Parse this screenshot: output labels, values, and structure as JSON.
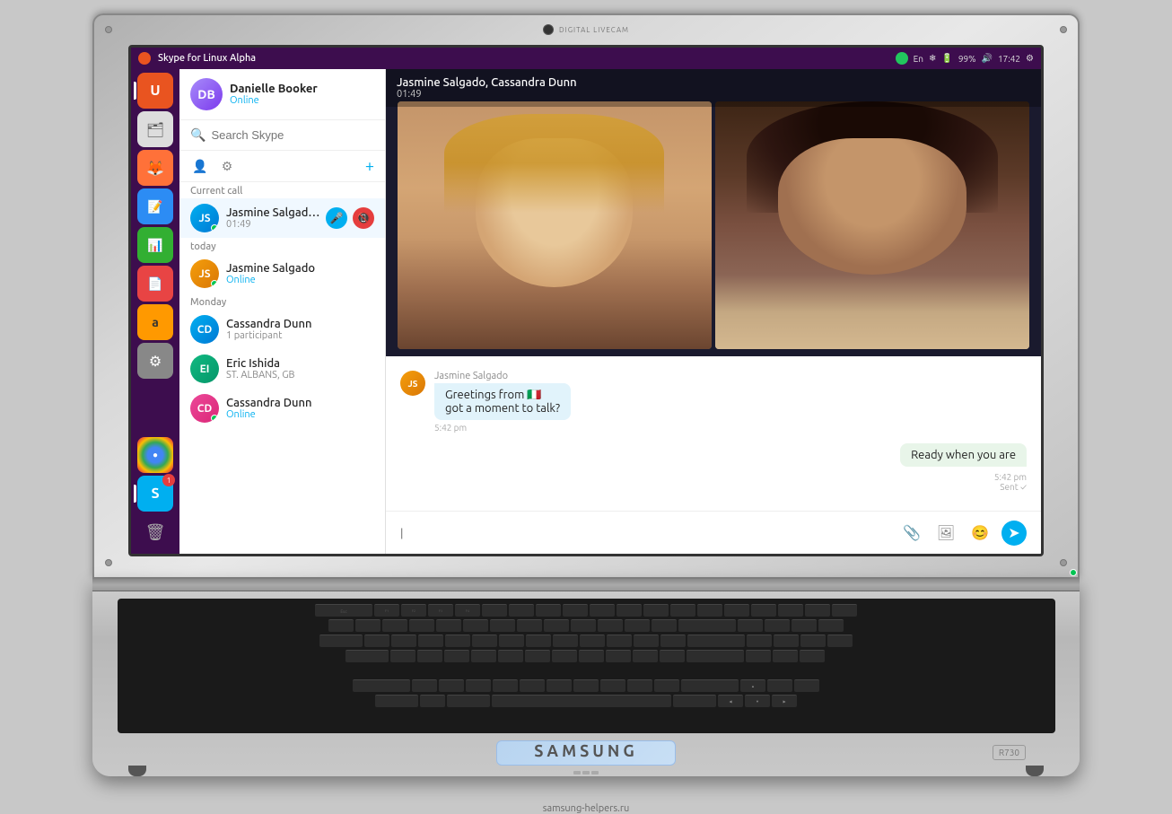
{
  "system_bar": {
    "title": "Skype for Linux Alpha",
    "time": "17:42",
    "battery": "99%",
    "indicators": [
      "●",
      "En",
      "❄",
      "🔊",
      "⚙"
    ]
  },
  "profile": {
    "name": "Danielle Booker",
    "status": "Online",
    "initials": "DB"
  },
  "search": {
    "placeholder": "Search Skype"
  },
  "toolbar": {
    "contacts_icon": "👤",
    "settings_icon": "⚙",
    "add_icon": "+"
  },
  "current_call": {
    "label": "Current call",
    "name": "Jasmine Salgado, Ca...",
    "timer": "01:49",
    "initials": "JS"
  },
  "sections": {
    "today": "today",
    "monday": "Monday"
  },
  "contacts": [
    {
      "id": "jasmine",
      "name": "Jasmine Salgado",
      "status": "Online",
      "status_type": "online",
      "initials": "JS"
    },
    {
      "id": "cassandra-group",
      "name": "Cassandra Dunn",
      "sub": "1 participant",
      "initials": "CD"
    },
    {
      "id": "eric",
      "name": "Eric Ishida",
      "sub": "ST. ALBANS, GB",
      "initials": "EI"
    },
    {
      "id": "cassandra2",
      "name": "Cassandra Dunn",
      "status": "Online",
      "status_type": "online",
      "initials": "CD"
    }
  ],
  "video_call": {
    "participants": "Jasmine Salgado, Cassandra Dunn",
    "timer": "01:49"
  },
  "messages": [
    {
      "sender": "Jasmine Salgado",
      "text1": "Greetings from 🇮🇹",
      "text2": "got a moment to talk?",
      "time": "5:42 pm",
      "type": "received"
    },
    {
      "text": "Ready when you are",
      "time": "5:42 pm",
      "type": "sent",
      "status": "Sent ✓"
    }
  ],
  "input": {
    "placeholder": "|",
    "icons": [
      "📎",
      "🖼",
      "😊",
      "➤"
    ]
  },
  "launcher": {
    "icons": [
      {
        "name": "ubuntu",
        "glyph": "🐧",
        "color": "#E95420"
      },
      {
        "name": "files",
        "glyph": "📁",
        "color": "#e0e0e0"
      },
      {
        "name": "firefox",
        "glyph": "🦊",
        "color": "#FF7139"
      },
      {
        "name": "text-editor",
        "glyph": "📝",
        "color": "#2c8cf4"
      },
      {
        "name": "spreadsheet",
        "glyph": "📊",
        "color": "#32af32"
      },
      {
        "name": "document",
        "glyph": "📄",
        "color": "#e84444"
      },
      {
        "name": "amazon",
        "glyph": "a",
        "color": "#FF9900"
      },
      {
        "name": "system-settings",
        "glyph": "⚙",
        "color": "#b0b0b0"
      },
      {
        "name": "chrome",
        "glyph": "●",
        "color": "#4285F4"
      },
      {
        "name": "skype",
        "glyph": "S",
        "color": "#00aff0"
      }
    ]
  },
  "laptop": {
    "brand": "SAMSUNG",
    "model": "R730",
    "website": "samsung-helpers.ru"
  }
}
